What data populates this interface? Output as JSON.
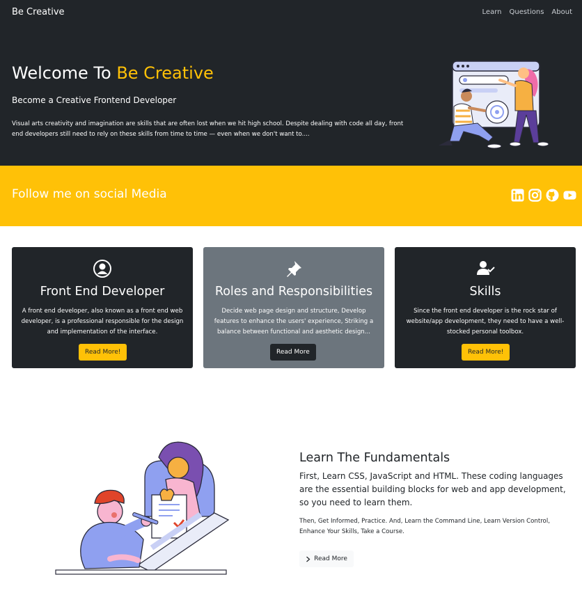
{
  "navbar": {
    "brand": "Be Creative",
    "links": [
      "Learn",
      "Questions",
      "About"
    ]
  },
  "hero": {
    "title_prefix": "Welcome To ",
    "title_accent": "Be Creative",
    "subtitle": "Become a Creative Frontend Developer",
    "text": "Visual arts creativity and imagination are skills that are often lost when we hit high school. Despite dealing with code all day, front end developers still need to rely on these skills from time to time — even when we don't want to....",
    "illustration": "two-developers-pointing-at-browser-window"
  },
  "social": {
    "title": "Follow me on social Media",
    "icons": [
      "linkedin-icon",
      "instagram-icon",
      "github-icon",
      "youtube-icon"
    ]
  },
  "cards": [
    {
      "icon": "user-circle-icon",
      "title": "Front End Developer",
      "text": "A front end developer, also known as a front end web developer, is a professional responsible for the design and implementation of the interface.",
      "button": "Read More!"
    },
    {
      "icon": "pushpin-icon",
      "title": "Roles and Responsibilities",
      "text": "Decide web page design and structure, Develop features to enhance the users' experience, Striking a balance between functional and aesthetic design...",
      "button": "Read More"
    },
    {
      "icon": "user-check-icon",
      "title": "Skills",
      "text": "Since the front end developer is the rock star of website/app development, they need to have a well-stocked personal toolbox.",
      "button": "Read More!"
    }
  ],
  "fundamentals": {
    "title": "Learn The Fundamentals",
    "lead": "First, Learn CSS, JavaScript and HTML. These coding languages are the essential building blocks for web and app development, so you need to learn them.",
    "text": "Then, Get Informed, Practice. And, Learn the Command Line, Learn Version Control, Enhance Your Skills, Take a Course.",
    "button": "Read More",
    "illustration": "developer-checking-document-at-laptop"
  },
  "colors": {
    "dark": "#212529",
    "accent": "#ffc107",
    "gray": "#6c757d",
    "light": "#f8f9fa"
  }
}
